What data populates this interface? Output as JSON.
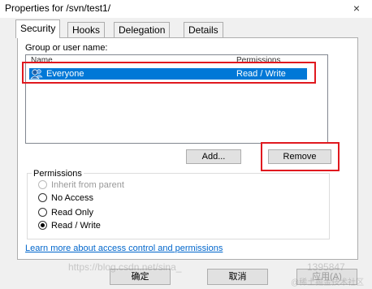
{
  "window": {
    "title": "Properties for /svn/test1/",
    "close_glyph": "×"
  },
  "tabs": [
    {
      "label": "Security",
      "active": true
    },
    {
      "label": "Hooks",
      "active": false
    },
    {
      "label": "Delegation",
      "active": false
    },
    {
      "label": "Details",
      "active": false
    }
  ],
  "security": {
    "group_label": "Group or user name:",
    "columns": {
      "name": "Name",
      "permissions": "Permissions"
    },
    "rows": [
      {
        "name": "Everyone",
        "permissions": "Read / Write",
        "selected": true,
        "icon": "users-group-icon"
      }
    ],
    "add_button": "Add...",
    "remove_button": "Remove",
    "permissions_group": "Permissions",
    "options": [
      {
        "label": "Inherit from parent",
        "checked": false,
        "disabled": true
      },
      {
        "label": "No Access",
        "checked": false,
        "disabled": false
      },
      {
        "label": "Read Only",
        "checked": false,
        "disabled": false
      },
      {
        "label": "Read / Write",
        "checked": true,
        "disabled": false
      }
    ],
    "help_link": "Learn more about access control and permissions"
  },
  "footer": {
    "ok": "确定",
    "cancel": "取消",
    "apply": "应用(A)"
  },
  "watermark": {
    "url": "https://blog.csdn.net/sina_",
    "tail": "1395847",
    "brand": "@稀土掘金技术社区"
  },
  "colors": {
    "selection": "#0078d7",
    "annotation": "#e0191f",
    "link": "#0066cc"
  }
}
